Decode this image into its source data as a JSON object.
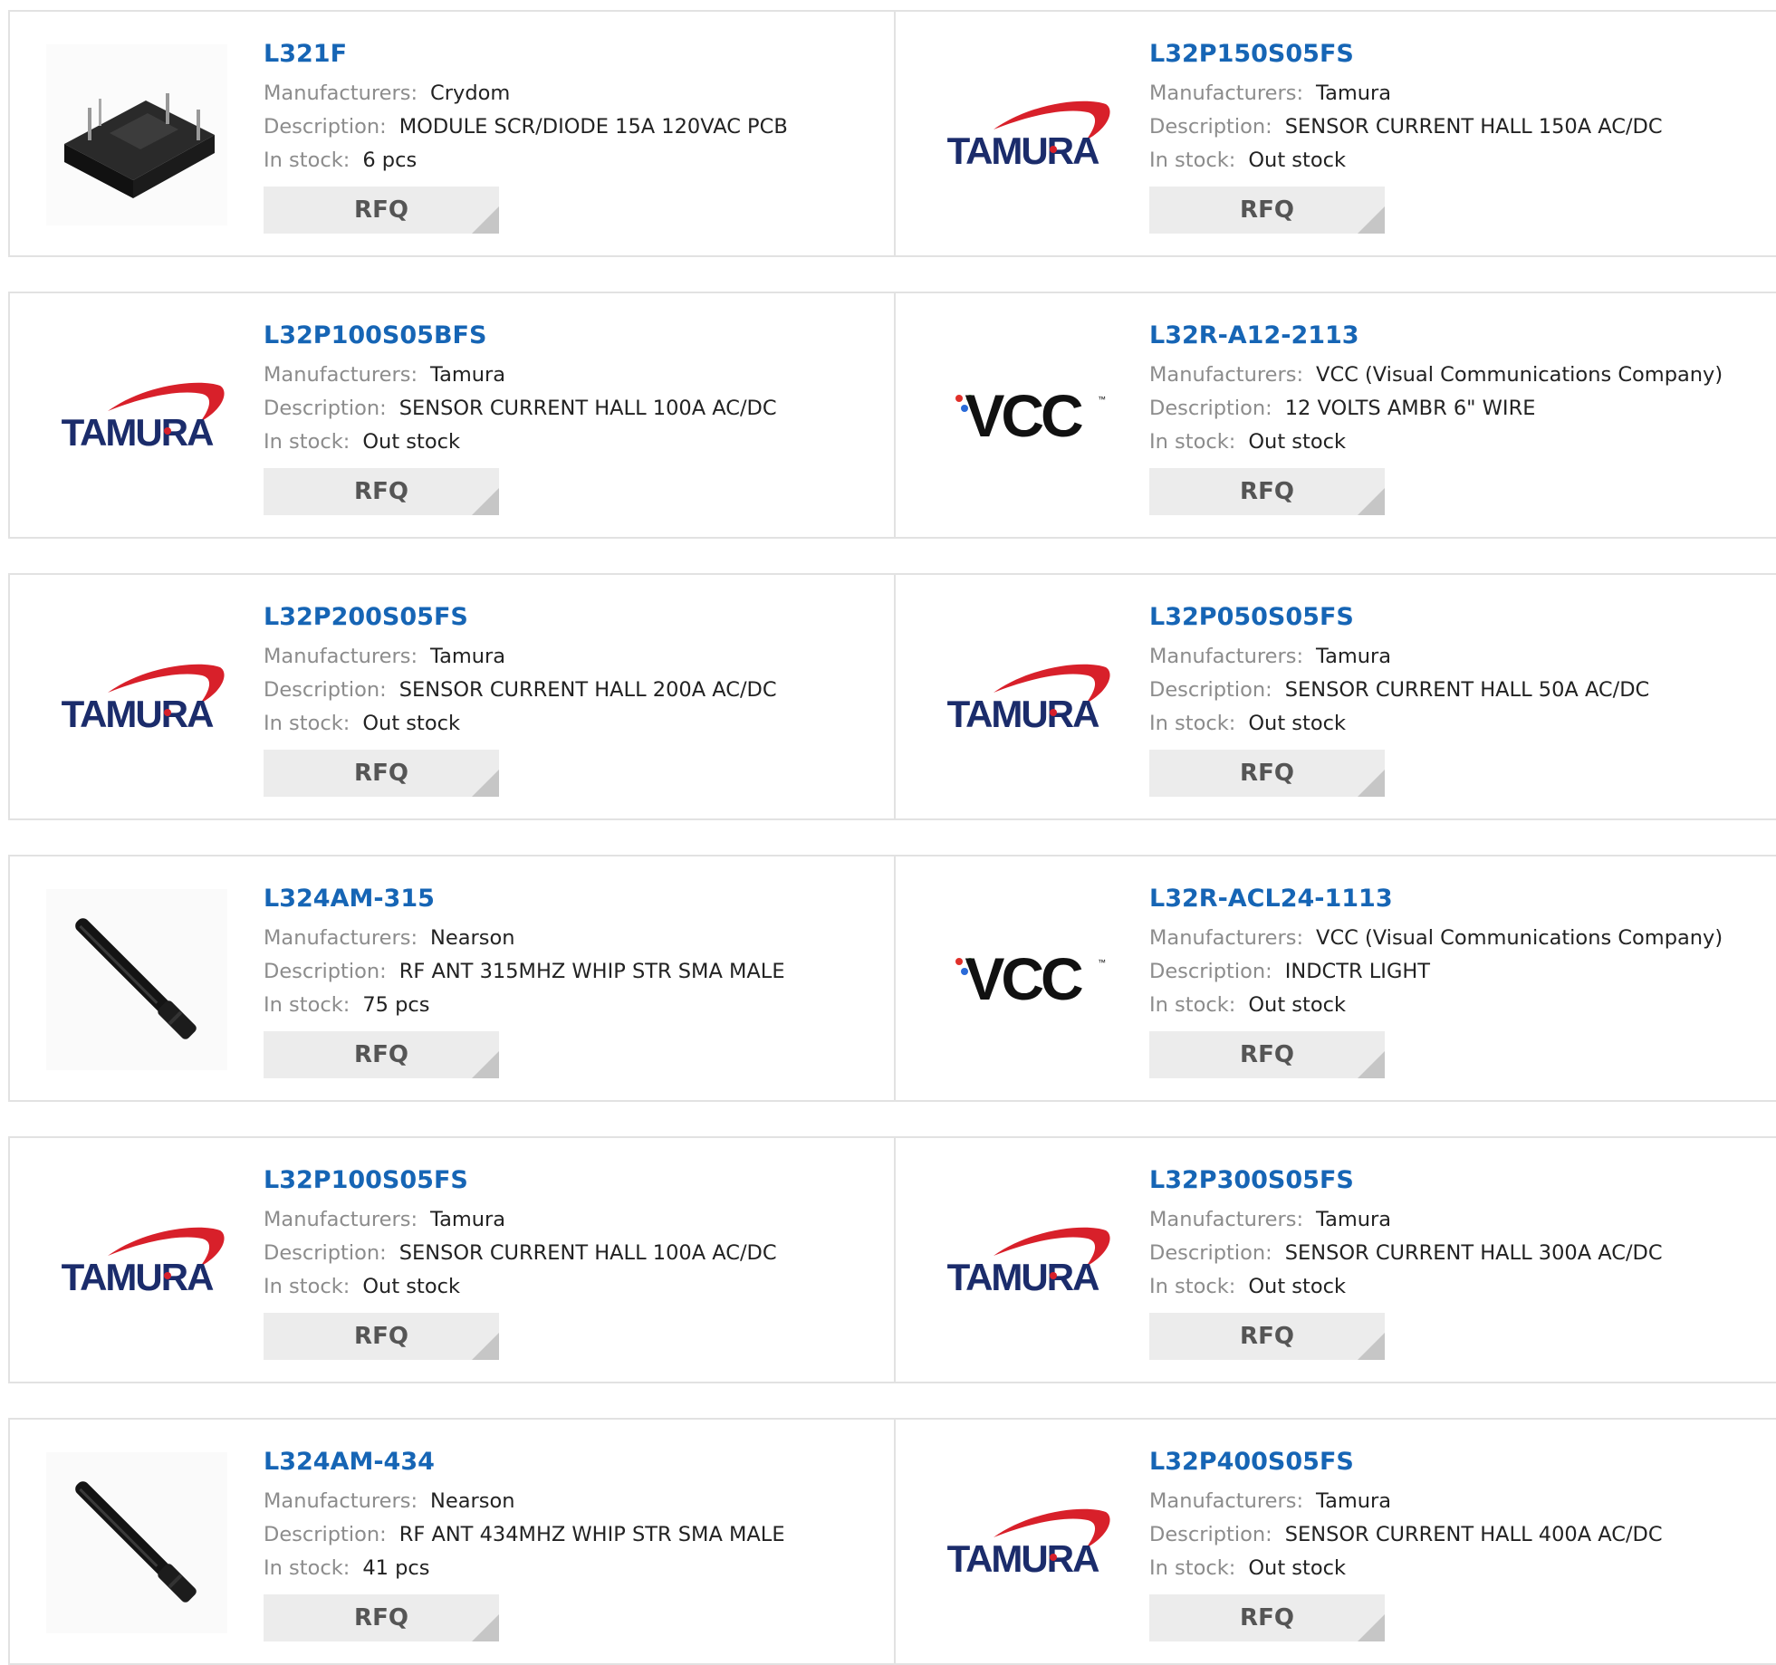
{
  "labels": {
    "manufacturers": "Manufacturers:",
    "description": "Description:",
    "in_stock": "In stock:",
    "rfq": "RFQ"
  },
  "logos": {
    "tamura": "TAMURA",
    "vcc": "VCC",
    "vcc_tm": "™"
  },
  "colors": {
    "part_link": "#1665b5",
    "label": "#8c8c8c",
    "value": "#222222",
    "rfq_bg": "#ececec",
    "border": "#e2e2e2",
    "tamura_red": "#d8202a",
    "tamura_navy": "#1b2c6b"
  },
  "products": [
    {
      "part": "L321F",
      "manufacturer": "Crydom",
      "description": "MODULE SCR/DIODE 15A 120VAC PCB",
      "stock": "6 pcs",
      "image": "scr-module-photo"
    },
    {
      "part": "L32P150S05FS",
      "manufacturer": "Tamura",
      "description": "SENSOR CURRENT HALL 150A AC/DC",
      "stock": "Out stock",
      "image": "tamura-logo"
    },
    {
      "part": "L32P100S05BFS",
      "manufacturer": "Tamura",
      "description": "SENSOR CURRENT HALL 100A AC/DC",
      "stock": "Out stock",
      "image": "tamura-logo"
    },
    {
      "part": "L32R-A12-2113",
      "manufacturer": "VCC (Visual Communications Company)",
      "description": "12 VOLTS AMBR 6\" WIRE",
      "stock": "Out stock",
      "image": "vcc-logo"
    },
    {
      "part": "L32P200S05FS",
      "manufacturer": "Tamura",
      "description": "SENSOR CURRENT HALL 200A AC/DC",
      "stock": "Out stock",
      "image": "tamura-logo"
    },
    {
      "part": "L32P050S05FS",
      "manufacturer": "Tamura",
      "description": "SENSOR CURRENT HALL 50A AC/DC",
      "stock": "Out stock",
      "image": "tamura-logo"
    },
    {
      "part": "L324AM-315",
      "manufacturer": "Nearson",
      "description": "RF ANT 315MHZ WHIP STR SMA MALE",
      "stock": "75 pcs",
      "image": "antenna-photo"
    },
    {
      "part": "L32R-ACL24-1113",
      "manufacturer": "VCC (Visual Communications Company)",
      "description": "INDCTR LIGHT",
      "stock": "Out stock",
      "image": "vcc-logo"
    },
    {
      "part": "L32P100S05FS",
      "manufacturer": "Tamura",
      "description": "SENSOR CURRENT HALL 100A AC/DC",
      "stock": "Out stock",
      "image": "tamura-logo"
    },
    {
      "part": "L32P300S05FS",
      "manufacturer": "Tamura",
      "description": "SENSOR CURRENT HALL 300A AC/DC",
      "stock": "Out stock",
      "image": "tamura-logo"
    },
    {
      "part": "L324AM-434",
      "manufacturer": "Nearson",
      "description": "RF ANT 434MHZ WHIP STR SMA MALE",
      "stock": "41 pcs",
      "image": "antenna-photo"
    },
    {
      "part": "L32P400S05FS",
      "manufacturer": "Tamura",
      "description": "SENSOR CURRENT HALL 400A AC/DC",
      "stock": "Out stock",
      "image": "tamura-logo"
    }
  ]
}
